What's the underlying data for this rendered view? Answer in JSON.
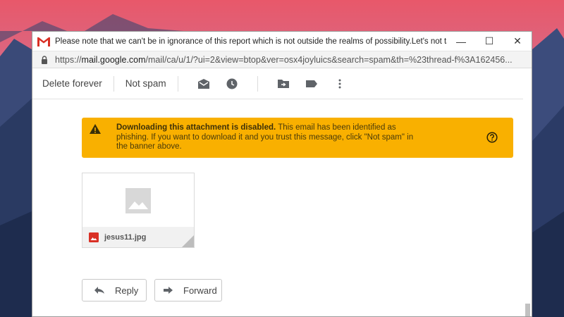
{
  "window": {
    "title": "Please note that we can't be in ignorance of this report which is not outside the realms of possibility.Let's not take a ch...",
    "minimize": "—",
    "maximize": "☐",
    "close": "✕"
  },
  "address": {
    "url_prefix": "https://",
    "url_host": "mail.google.com",
    "url_rest": "/mail/ca/u/1/?ui=2&view=btop&ver=osx4joyluics&search=spam&th=%23thread-f%3A162456..."
  },
  "toolbar": {
    "delete_forever": "Delete forever",
    "not_spam": "Not spam",
    "icons": [
      "mark-unread-icon",
      "snooze-icon",
      "move-to-icon",
      "label-icon",
      "more-options-icon"
    ]
  },
  "banner": {
    "title": "Downloading this attachment is disabled.",
    "body": " This email has been identified as phishing. If you want to download it and you trust this message, click \"Not spam\" in the banner above.",
    "color": "#f9b000"
  },
  "attachment": {
    "filename": "jesus11.jpg"
  },
  "actions": {
    "reply": "Reply",
    "forward": "Forward"
  }
}
